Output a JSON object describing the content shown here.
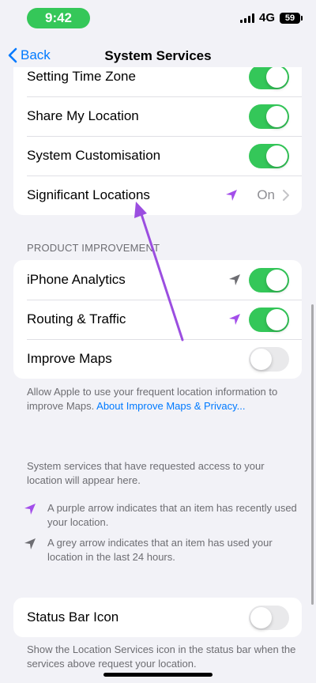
{
  "status": {
    "time": "9:42",
    "network": "4G",
    "battery": "59"
  },
  "nav": {
    "back_label": "Back",
    "title": "System Services"
  },
  "location_group": {
    "rows": [
      {
        "label": "Setting Time Zone",
        "toggle": "on"
      },
      {
        "label": "Share My Location",
        "toggle": "on"
      },
      {
        "label": "System Customisation",
        "toggle": "on"
      },
      {
        "label": "Significant Locations",
        "value": "On",
        "arrow_color": "#a34eea"
      }
    ]
  },
  "product_improvement": {
    "header": "PRODUCT IMPROVEMENT",
    "rows": [
      {
        "label": "iPhone Analytics",
        "toggle": "on",
        "arrow_color": "#6d6d72"
      },
      {
        "label": "Routing & Traffic",
        "toggle": "on",
        "arrow_color": "#a34eea"
      },
      {
        "label": "Improve Maps",
        "toggle": "off"
      }
    ],
    "footer_text": "Allow Apple to use your frequent location information to improve Maps.",
    "footer_link": "About Improve Maps & Privacy..."
  },
  "info": {
    "intro": "System services that have requested access to your location will appear here.",
    "purple_text": "A purple arrow indicates that an item has recently used your location.",
    "grey_text": "A grey arrow indicates that an item has used your location in the last 24 hours."
  },
  "status_bar_icon": {
    "label": "Status Bar Icon",
    "toggle": "off",
    "footer": "Show the Location Services icon in the status bar when the services above request your location."
  },
  "colors": {
    "accent": "#007aff",
    "toggle_on": "#34c759",
    "purple": "#a34eea",
    "annotation": "#9b4ee0"
  }
}
